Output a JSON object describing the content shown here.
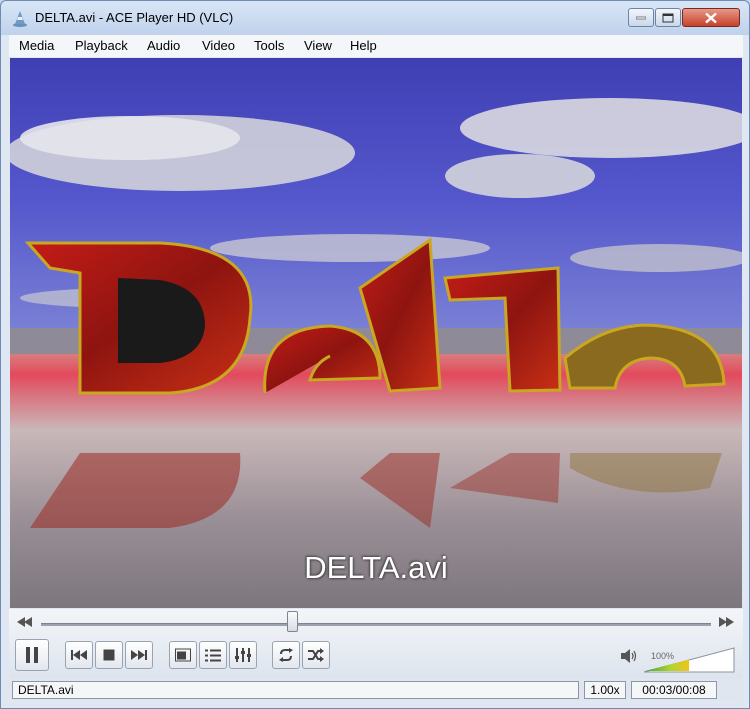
{
  "window": {
    "title": "DELTA.avi - ACE Player HD (VLC)"
  },
  "menu": {
    "items": [
      "Media",
      "Playback",
      "Audio",
      "Video",
      "Tools",
      "View",
      "Help"
    ]
  },
  "video": {
    "subtitle": "DELTA.avi"
  },
  "playback": {
    "progress_fraction": 0.375
  },
  "volume": {
    "label": "100%",
    "level_fraction": 1.0
  },
  "status": {
    "filename": "DELTA.avi",
    "speed": "1.00x",
    "time": "00:03/00:08"
  },
  "colors": {
    "accent": "#3b6fb6",
    "sky": "#4a53c4",
    "letters": "#b8201c"
  },
  "icons": [
    "vlc-cone-icon",
    "minimize-icon",
    "maximize-icon",
    "close-icon",
    "rewind-icon",
    "forward-icon",
    "pause-icon",
    "previous-icon",
    "stop-icon",
    "next-icon",
    "fullscreen-icon",
    "playlist-icon",
    "equalizer-icon",
    "loop-icon",
    "shuffle-icon",
    "speaker-icon"
  ]
}
